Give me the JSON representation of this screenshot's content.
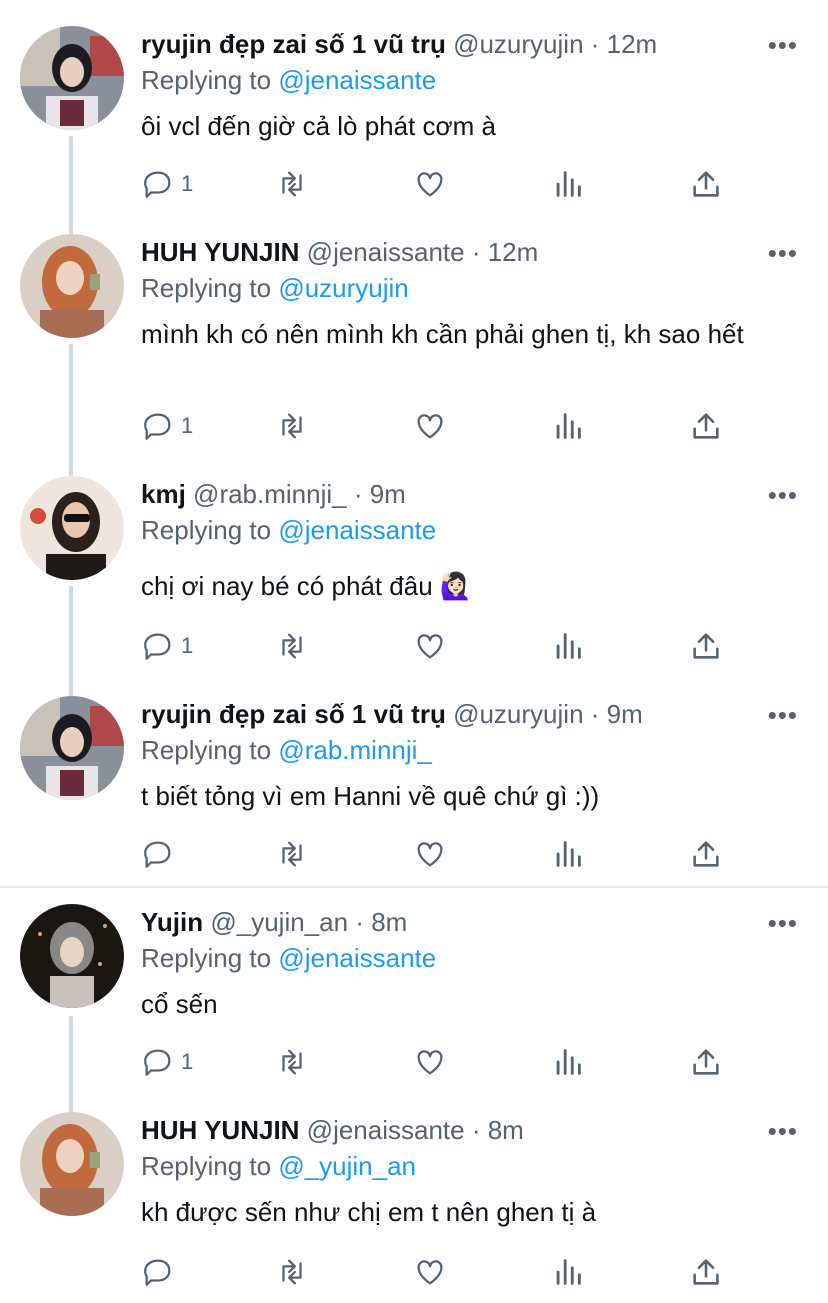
{
  "colors": {
    "link": "#1d9bf0",
    "meta": "#536471",
    "text": "#0f1419"
  },
  "tweets": [
    {
      "name": "ryujin đẹp zai số 1 vũ trụ",
      "handle": "@uzuryujin",
      "time": "12m",
      "replying_prefix": "Replying to ",
      "replying_to": "@jenaissante",
      "text": "ôi vcl đến giờ cả lò phát cơm à",
      "reply_count": "1",
      "avatar": "girl-dark-hair-icon"
    },
    {
      "name": "HUH YUNJIN",
      "handle": "@jenaissante",
      "time": "12m",
      "replying_prefix": "Replying to ",
      "replying_to": "@uzuryujin",
      "text": "mình kh có nên mình kh cần phải ghen tị, kh sao hết",
      "reply_count": "1",
      "avatar": "girl-auburn-hair-icon"
    },
    {
      "name": "kmj",
      "handle": "@rab.minnji_",
      "time": "9m",
      "replying_prefix": "Replying to ",
      "replying_to": "@jenaissante",
      "text": "chị ơi nay bé có phát đâu 🙋🏻‍♀️",
      "reply_count": "1",
      "avatar": "girl-sunglasses-icon"
    },
    {
      "name": "ryujin đẹp zai số 1 vũ trụ",
      "handle": "@uzuryujin",
      "time": "9m",
      "replying_prefix": "Replying to ",
      "replying_to": "@rab.minnji_",
      "text": "t biết tỏng vì em Hanni về quê chứ gì :))",
      "reply_count": "",
      "avatar": "girl-dark-hair-icon"
    },
    {
      "name": "Yujin",
      "handle": "@_yujin_an",
      "time": "8m",
      "replying_prefix": "Replying to ",
      "replying_to": "@jenaissante",
      "text": "cổ sến",
      "reply_count": "1",
      "avatar": "girl-hood-icon"
    },
    {
      "name": "HUH YUNJIN",
      "handle": "@jenaissante",
      "time": "8m",
      "replying_prefix": "Replying to ",
      "replying_to": "@_yujin_an",
      "text": "kh được sến như chị em t nên ghen tị à",
      "reply_count": "",
      "avatar": "girl-auburn-hair-icon"
    }
  ],
  "more_label": "•••",
  "dot": " · "
}
